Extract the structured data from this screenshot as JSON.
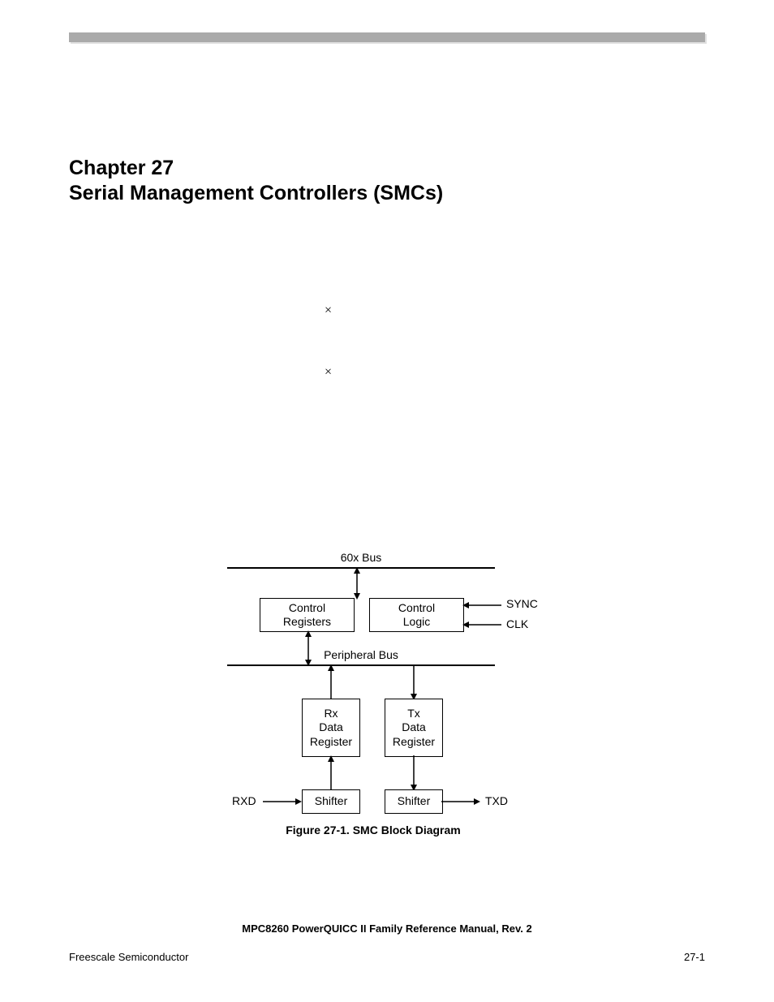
{
  "chapter": {
    "number": "Chapter 27",
    "title": "Serial Management Controllers (SMCs)"
  },
  "marks": {
    "cross": "×"
  },
  "diagram": {
    "top_bus": "60x Bus",
    "mid_bus": "Peripheral Bus",
    "control_registers_l1": "Control",
    "control_registers_l2": "Registers",
    "control_logic_l1": "Control",
    "control_logic_l2": "Logic",
    "rx_l1": "Rx",
    "rx_l2": "Data",
    "rx_l3": "Register",
    "tx_l1": "Tx",
    "tx_l2": "Data",
    "tx_l3": "Register",
    "shifter_left": "Shifter",
    "shifter_right": "Shifter",
    "sync": "SYNC",
    "clk": "CLK",
    "rxd": "RXD",
    "txd": "TXD",
    "caption": "Figure 27-1. SMC Block Diagram"
  },
  "footer": {
    "manual": "MPC8260 PowerQUICC II Family Reference Manual, Rev. 2",
    "vendor": "Freescale Semiconductor",
    "page": "27-1"
  }
}
